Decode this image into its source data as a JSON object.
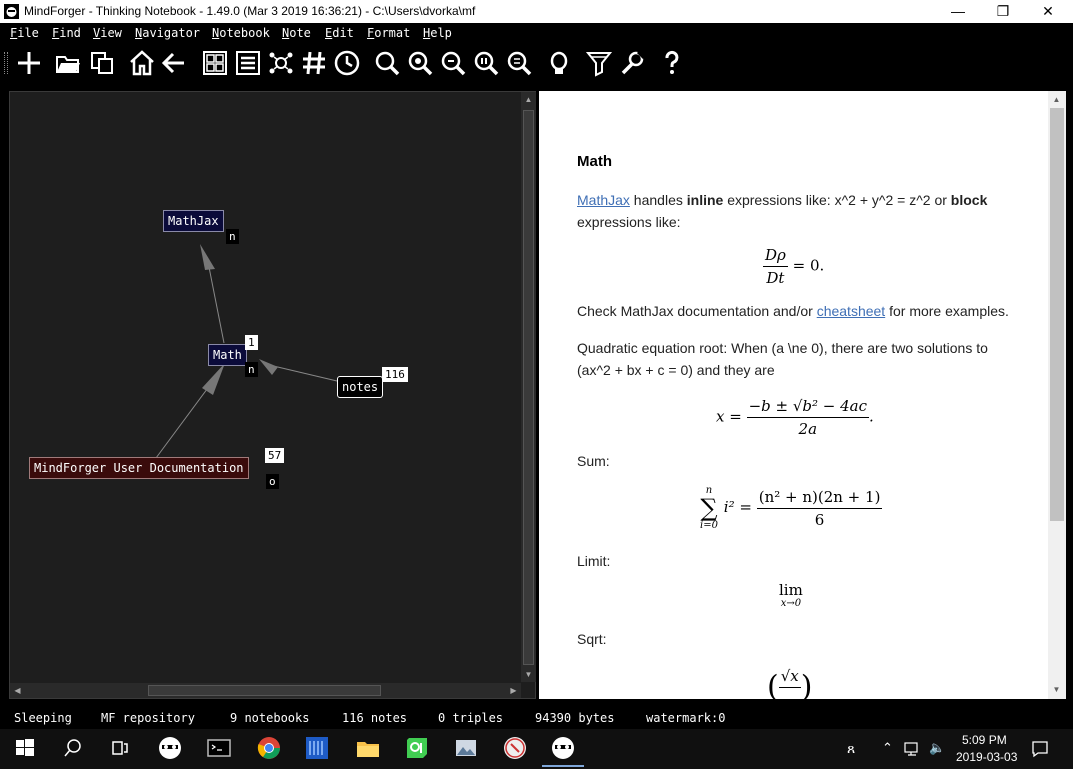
{
  "window": {
    "title": "MindForger - Thinking Notebook - 1.49.0 (Mar  3 2019 16:36:21) - C:\\Users\\dvorka\\mf",
    "minimize": "—",
    "maximize": "❐",
    "close": "✕"
  },
  "menu": [
    "File",
    "Find",
    "View",
    "Navigator",
    "Notebook",
    "Note",
    "Edit",
    "Format",
    "Help"
  ],
  "toolbar": {
    "icons": [
      "new-icon",
      "open-folder-icon",
      "copy-icon",
      "home-icon",
      "back-arrow-icon",
      "grid-view-icon",
      "list-view-icon",
      "navigator-icon",
      "hashtag-icon",
      "clock-icon",
      "find-icon",
      "find-text-icon",
      "find-exact-icon",
      "find-regexp-icon",
      "find-tag-icon",
      "think-icon",
      "filter-icon",
      "settings-icon",
      "help-icon"
    ]
  },
  "graph": {
    "nodes": [
      {
        "label": "MathJax",
        "badges": [
          "n"
        ]
      },
      {
        "label": "Math",
        "badges": [
          "1",
          "n"
        ]
      },
      {
        "label": "notes",
        "badges": [
          "116"
        ]
      },
      {
        "label": "MindForger User Documentation",
        "badges": [
          "57",
          "o"
        ]
      }
    ]
  },
  "document": {
    "heading": "Math",
    "p1_link": "MathJax",
    "p1_a": " handles ",
    "p1_b": "inline",
    "p1_c": " expressions like: x^2 + y^2 = z^2 or ",
    "p1_d": "block",
    "p1_e": " expressions like:",
    "eq1_num": "Dρ",
    "eq1_den": "Dt",
    "eq1_rest": "= 0.",
    "p2_a": "Check MathJax documentation and/or ",
    "p2_link": "cheatsheet",
    "p2_b": " for more examples.",
    "p3": "Quadratic equation root: When (a \\ne 0), there are two solutions to (ax^2 + bx + c = 0) and they are",
    "eq2_lhs": "x =",
    "eq2_num": "−b ± √b² − 4ac",
    "eq2_den": "2a",
    "eq2_end": ".",
    "sum_label": "Sum:",
    "eq3_top": "n",
    "eq3_sigma": "∑",
    "eq3_bottom": "i=0",
    "eq3_mid": "i² =",
    "eq3_num": "(n² + n)(2n + 1)",
    "eq3_den": "6",
    "limit_label": "Limit:",
    "eq4_lim": "lim",
    "eq4_sub": "x→0",
    "sqrt_label": "Sqrt:",
    "eq5": "√x"
  },
  "status": [
    "Sleeping",
    "MF repository",
    "9 notebooks",
    "116 notes",
    "0 triples",
    "94390 bytes",
    "watermark:0"
  ],
  "taskbar": {
    "icons": [
      "windows-start-icon",
      "search-icon",
      "task-view-icon",
      "mindforger-icon",
      "terminal-icon",
      "chrome-icon",
      "visual-studio-icon",
      "file-explorer-icon",
      "qt-creator-icon",
      "photo-icon",
      "compass-icon",
      "mindforger-active-icon"
    ],
    "time": "5:09 PM",
    "date": "2019-03-03"
  },
  "colors": {
    "graph_bg": "#1e1e1e",
    "link": "#3f6fb5",
    "node_blue": "#0b0b3a",
    "node_red": "#3a0b0b"
  }
}
